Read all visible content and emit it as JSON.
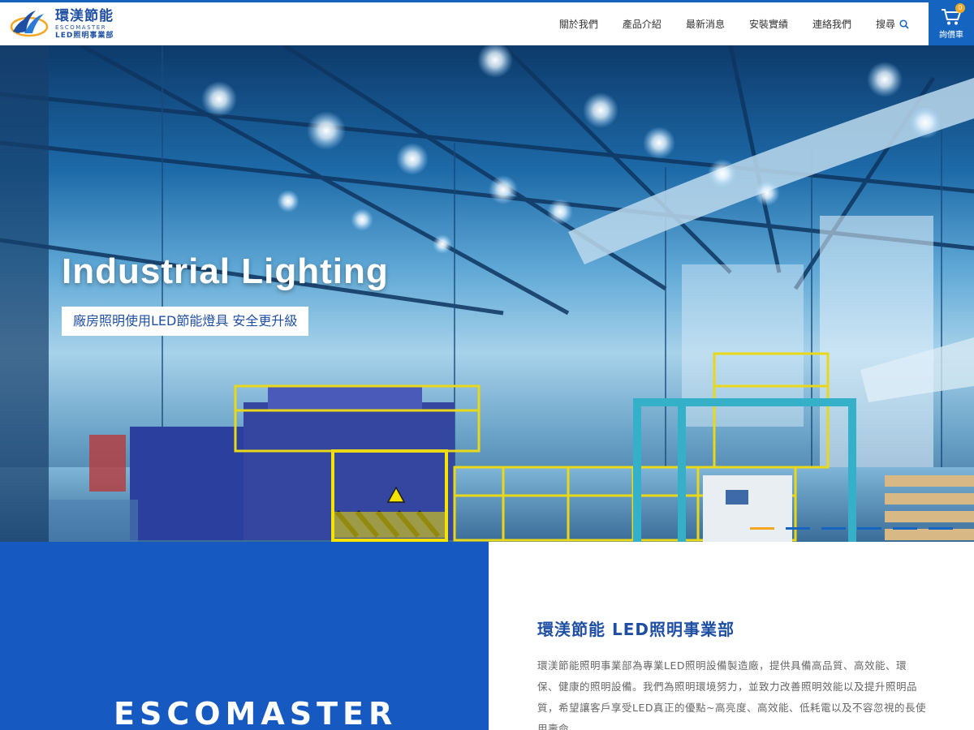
{
  "header": {
    "logo": {
      "name_cn": "環渼節能",
      "name_en": "ESCOMASTER",
      "division": "LED照明事業部"
    },
    "nav": [
      {
        "label": "關於我們"
      },
      {
        "label": "產品介紹"
      },
      {
        "label": "最新消息"
      },
      {
        "label": "安裝實績"
      },
      {
        "label": "連絡我們"
      }
    ],
    "search_label": "搜尋",
    "cart": {
      "count": "0",
      "label": "詢價車"
    }
  },
  "hero": {
    "title": "Industrial Lighting",
    "tagline": "廠房照明使用LED節能燈具 安全更升級",
    "slides": 6,
    "active_slide": 1
  },
  "intro": {
    "brand": "ESCOMASTER",
    "title": "環渼節能 LED照明事業部",
    "body": "環渼節能照明事業部為專業LED照明設備製造廠，提供具備高品質、高效能、環保、健康的照明設備。我們為照明環境努力，並致力改善照明效能以及提升照明品質，希望讓客戶享受LED真正的優點~高亮度、高效能、低耗電以及不容忽視的長使用壽命。"
  },
  "colors": {
    "primary": "#1565c0",
    "panel": "#1559c1",
    "accent": "#f5a623"
  }
}
